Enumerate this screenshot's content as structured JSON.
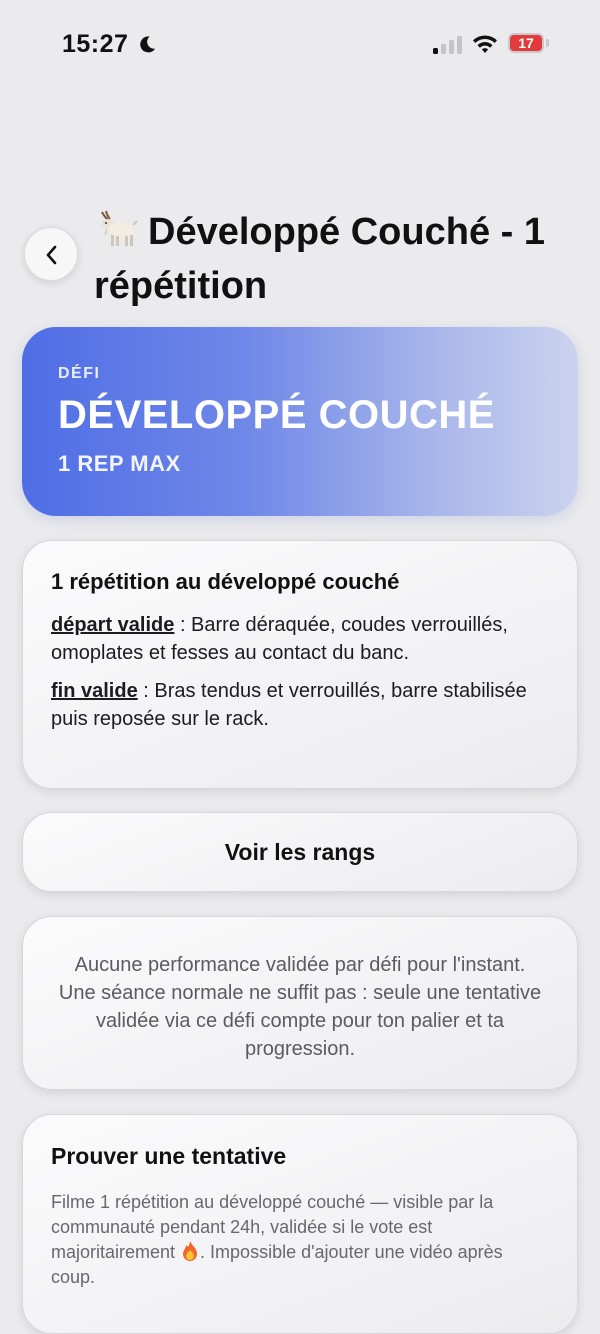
{
  "status_bar": {
    "time": "15:27",
    "battery_level": "17",
    "icons": [
      "moon-icon",
      "signal-icon",
      "wifi-icon",
      "battery-icon"
    ]
  },
  "header": {
    "title": "Développé Couché - 1 répétition",
    "emoji_icon": "goat-icon"
  },
  "banner": {
    "kicker": "DÉFI",
    "title": "DÉVELOPPÉ COUCHÉ",
    "subtitle": "1 REP MAX",
    "gradient_colors": [
      "#4f6ee6",
      "#ccd3ef"
    ]
  },
  "rules_card": {
    "title": "1 répétition au développé couché",
    "start_label": "départ valide",
    "start_text": " : Barre déraquée, coudes verrouillés, omoplates et fesses au contact du banc.",
    "end_label": "fin valide",
    "end_text": " : Bras tendus et verrouillés, barre stabilisée puis reposée sur le rack."
  },
  "ranks_button": {
    "label": "Voir les rangs"
  },
  "info_card": {
    "text": "Aucune performance validée par défi pour l'instant. Une séance normale ne suffit pas : seule une tentative validée via ce défi compte pour ton palier et ta progression."
  },
  "prove_card": {
    "title": "Prouver une tentative",
    "text_before": "Filme 1 répétition au développé couché — visible par la communauté pendant 24h, validée si le vote est majoritairement ",
    "text_after": ". Impossible d'ajouter une vidéo après coup.",
    "emoji_icon": "fire-icon"
  }
}
